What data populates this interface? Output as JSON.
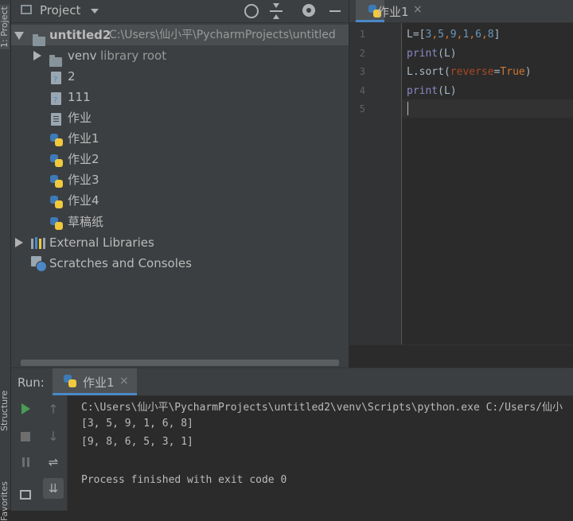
{
  "left_strip": {
    "project_label": "1: Project",
    "structure_label": "Structure",
    "favorites_label": "Favorites"
  },
  "project": {
    "header": {
      "title": "Project",
      "dropdown_icon": "chevron-down-icon"
    },
    "tree": [
      {
        "id": "root",
        "label": "untitled2",
        "hint": "C:\\Users\\仙小平\\PycharmProjects\\untitled",
        "kind": "folder",
        "expanded": true
      },
      {
        "id": "venv",
        "label": "venv",
        "hint": "library root",
        "kind": "folder",
        "expanded": false
      },
      {
        "id": "file-2",
        "label": "2",
        "kind": "unknown-file"
      },
      {
        "id": "file-111",
        "label": "111",
        "kind": "unknown-file"
      },
      {
        "id": "file-zuoye",
        "label": "作业",
        "kind": "text-file"
      },
      {
        "id": "file-zuoye1",
        "label": "作业1",
        "kind": "python-file"
      },
      {
        "id": "file-zuoye2",
        "label": "作业2",
        "kind": "python-file"
      },
      {
        "id": "file-zuoye3",
        "label": "作业3",
        "kind": "python-file"
      },
      {
        "id": "file-zuoye4",
        "label": "作业4",
        "kind": "python-file"
      },
      {
        "id": "file-caogao",
        "label": "草稿纸",
        "kind": "python-file"
      },
      {
        "id": "ext-libs",
        "label": "External Libraries",
        "kind": "libraries"
      },
      {
        "id": "scratches",
        "label": "Scratches and Consoles",
        "kind": "scratches"
      }
    ]
  },
  "editor": {
    "tab": {
      "label": "作业1",
      "close": "×"
    },
    "line_numbers": [
      "1",
      "2",
      "3",
      "4",
      "5"
    ],
    "code": {
      "l1_a": "L",
      "l1_b": "=[",
      "l1_c": "3",
      "l1_d": ",",
      "l1_e": "5",
      "l1_f": ",",
      "l1_g": "9",
      "l1_h": ",",
      "l1_i": "1",
      "l1_j": ",",
      "l1_k": "6",
      "l1_l": ",",
      "l1_m": "8",
      "l1_n": "]",
      "l2_a": "print",
      "l2_b": "(L)",
      "l3_a": "L.sort(",
      "l3_b": "reverse",
      "l3_c": "=",
      "l3_d": "True",
      "l3_e": ")",
      "l4_a": "print",
      "l4_b": "(L)"
    }
  },
  "run": {
    "label": "Run:",
    "tab": {
      "label": "作业1",
      "close": "×"
    },
    "console": [
      "C:\\Users\\仙小平\\PycharmProjects\\untitled2\\venv\\Scripts\\python.exe C:/Users/仙小",
      "[3, 5, 9, 1, 6, 8]",
      "[9, 8, 6, 5, 3, 1]",
      "",
      "Process finished with exit code 0"
    ]
  },
  "colors": {
    "accent": "#4a88c7",
    "run_green": "#499c54",
    "background": "#2b2b2b",
    "panel": "#3c3f41"
  }
}
